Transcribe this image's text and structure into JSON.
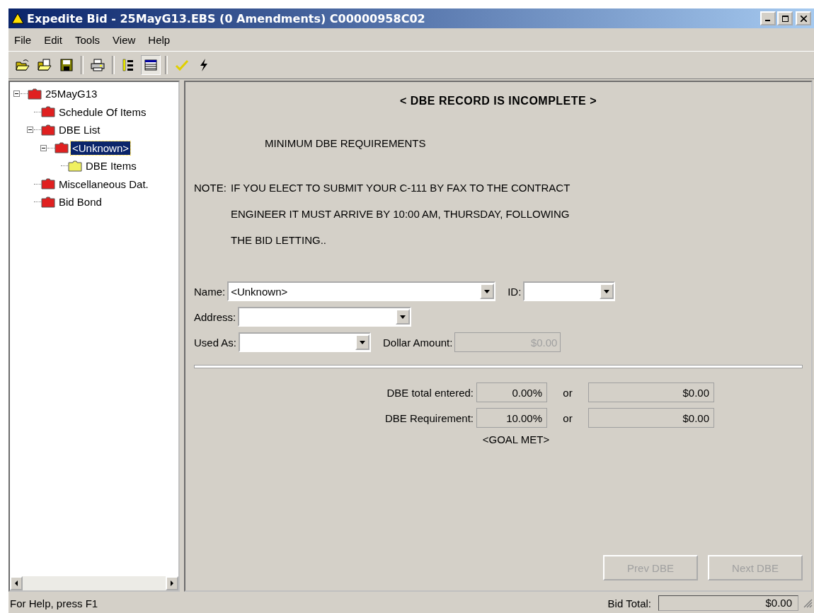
{
  "window": {
    "title": "Expedite Bid - 25MayG13.EBS (0 Amendments) C00000958C02"
  },
  "menu": [
    "File",
    "Edit",
    "Tools",
    "View",
    "Help"
  ],
  "toolbar": [
    {
      "kind": "open"
    },
    {
      "kind": "openfile"
    },
    {
      "kind": "save"
    },
    {
      "kind": "sep"
    },
    {
      "kind": "print"
    },
    {
      "kind": "sep"
    },
    {
      "kind": "tree",
      "pressed": false
    },
    {
      "kind": "list",
      "pressed": true
    },
    {
      "kind": "sep"
    },
    {
      "kind": "check"
    },
    {
      "kind": "bolt"
    }
  ],
  "tree": [
    {
      "label": "25MayG13",
      "color": "#e02020",
      "expanded": true,
      "selected": false,
      "children": [
        {
          "label": "Schedule Of Items",
          "color": "#e02020",
          "selected": false
        },
        {
          "label": "DBE List",
          "color": "#e02020",
          "expanded": true,
          "selected": false,
          "children": [
            {
              "label": "<Unknown>",
              "color": "#e02020",
              "expanded": true,
              "selected": true,
              "children": [
                {
                  "label": "DBE Items",
                  "color": "#f0f060",
                  "selected": false
                }
              ]
            }
          ]
        },
        {
          "label": "Miscellaneous Dat.",
          "color": "#e02020",
          "selected": false
        },
        {
          "label": "Bid Bond",
          "color": "#e02020",
          "selected": false
        }
      ]
    }
  ],
  "panel": {
    "heading": "< DBE RECORD IS INCOMPLETE >",
    "subheading": "MINIMUM DBE REQUIREMENTS",
    "note": {
      "label": "NOTE:",
      "lines": [
        "IF YOU ELECT TO SUBMIT YOUR C-111 BY FAX TO THE CONTRACT",
        "ENGINEER IT MUST ARRIVE BY 10:00 AM, THURSDAY, FOLLOWING",
        "THE BID LETTING.."
      ]
    },
    "name": {
      "label": "Name:",
      "value": "<Unknown>"
    },
    "id": {
      "label": "ID:"
    },
    "address": {
      "label": "Address:"
    },
    "used_as": {
      "label": "Used As:"
    },
    "dollar_amount": {
      "label": "Dollar Amount:",
      "value": "$0.00",
      "disabled": true
    },
    "totals": [
      {
        "label": "DBE total entered:",
        "percent": "0.00%",
        "or": "or",
        "amount": "$0.00"
      },
      {
        "label": "DBE Requirement:",
        "percent": "10.00%",
        "or": "or",
        "amount": "$0.00"
      }
    ],
    "goal": "<GOAL MET>",
    "buttons": [
      {
        "label": "Prev DBE",
        "disabled": true
      },
      {
        "label": "Next DBE",
        "disabled": true
      }
    ]
  },
  "status_bar": {
    "help": "For Help, press F1",
    "bid_total_label": "Bid Total:",
    "bid_total": "$0.00"
  }
}
